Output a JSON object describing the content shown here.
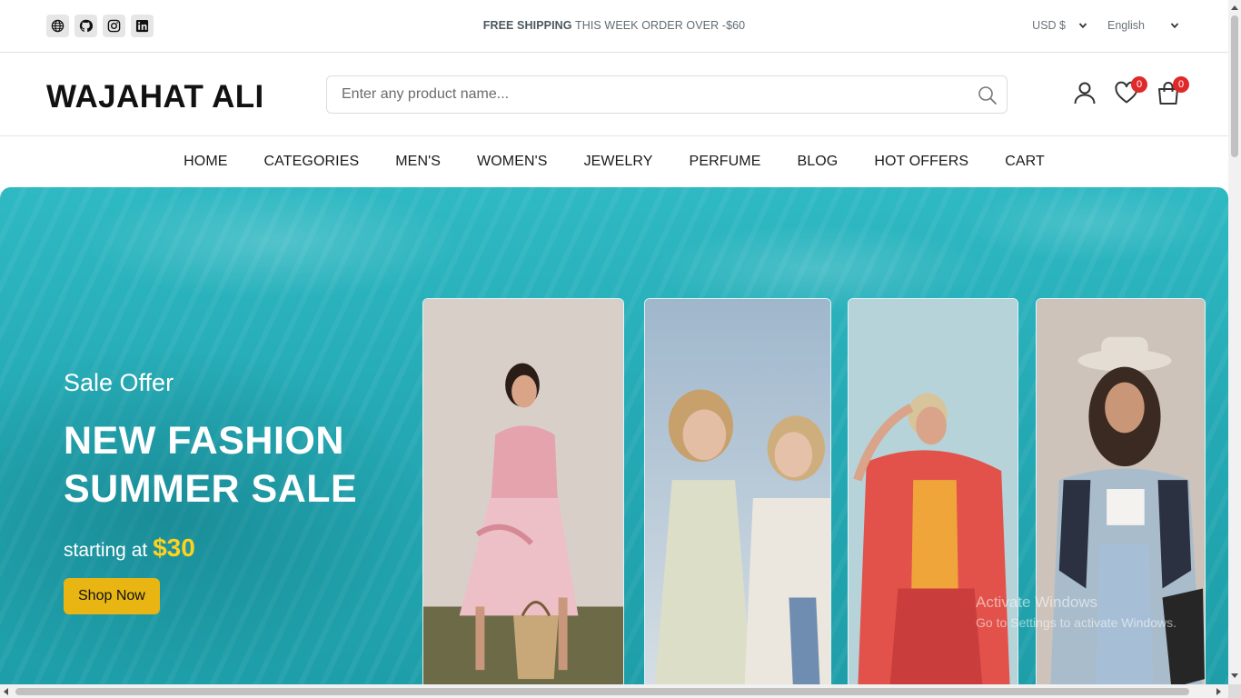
{
  "topbar": {
    "socials": [
      {
        "icon": "globe-icon"
      },
      {
        "icon": "github-icon"
      },
      {
        "icon": "instagram-icon"
      },
      {
        "icon": "linkedin-icon"
      }
    ],
    "promo_bold": "FREE SHIPPING",
    "promo_rest": "THIS WEEK ORDER OVER -$60",
    "currency": "USD $",
    "language": "English"
  },
  "header": {
    "brand": "WAJAHAT ALI",
    "search_placeholder": "Enter any product name...",
    "wishlist_count": "0",
    "cart_count": "0"
  },
  "nav": {
    "items": [
      "HOME",
      "CATEGORIES",
      "MEN'S",
      "WOMEN'S",
      "JEWELRY",
      "PERFUME",
      "BLOG",
      "HOT OFFERS",
      "CART"
    ]
  },
  "hero": {
    "subtitle": "Sale Offer",
    "title": "NEW FASHION SUMMER SALE",
    "starting_text": "starting at",
    "price": "$30",
    "button": "Shop Now"
  },
  "watermark": {
    "line1": "Activate Windows",
    "line2": "Go to Settings to activate Windows."
  },
  "colors": {
    "hero_bg": "#25aab5",
    "price": "#ffd21f",
    "button": "#e8b512",
    "badge": "#e02a2a"
  }
}
